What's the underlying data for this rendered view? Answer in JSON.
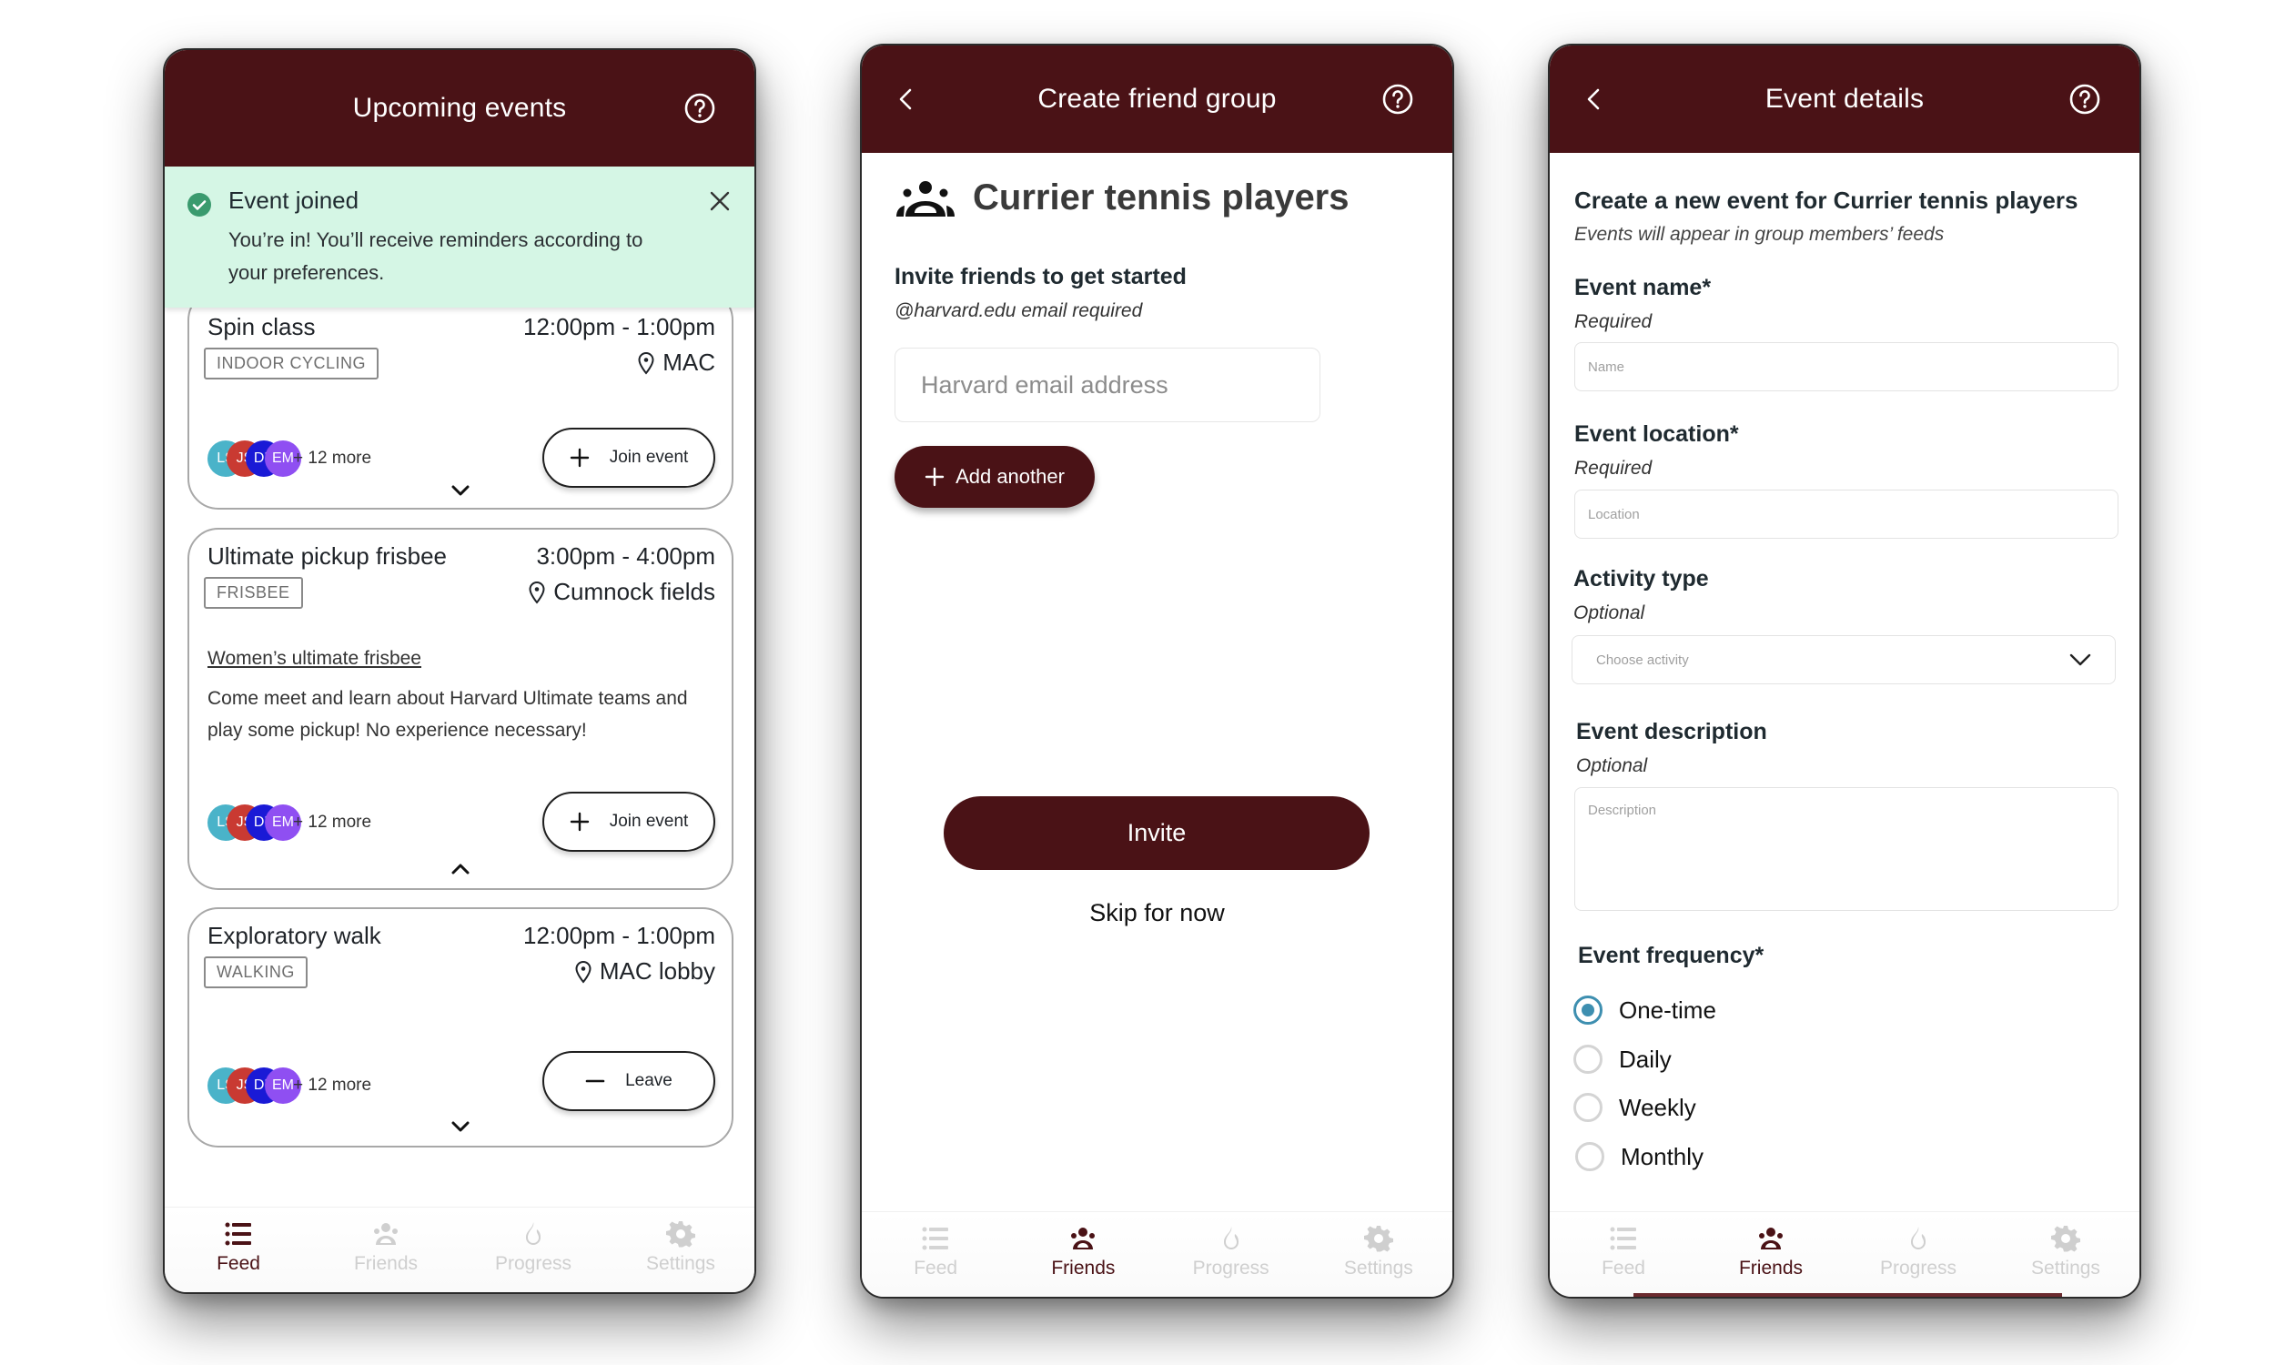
{
  "colors": {
    "brand": "#4a1216",
    "banner_bg": "#d5f6e5",
    "success": "#3a9a6e",
    "radio_accent": "#3e8fb0",
    "tab_inactive": "#cfcfcf"
  },
  "feed_screen": {
    "title": "Upcoming events",
    "help_icon": "help-circle-icon",
    "banner": {
      "icon": "check-circle-icon",
      "title": "Event joined",
      "message": "You’re in! You’ll receive reminders according to your preferences.",
      "close_icon": "close-icon"
    },
    "events": [
      {
        "title": "Spin class",
        "time": "12:00pm - 1:00pm",
        "tag": "INDOOR CYCLING",
        "location": "MAC",
        "group_link": "",
        "description": "",
        "attendees": [
          {
            "initials": "LS",
            "color": "#4ab3c9"
          },
          {
            "initials": "JS",
            "color": "#c93a32"
          },
          {
            "initials": "DK",
            "color": "#1a1ad6"
          },
          {
            "initials": "EM",
            "color": "#8f4ff2"
          }
        ],
        "more": "+ 12 more",
        "action": {
          "label": "Join event",
          "icon": "plus-icon"
        },
        "expand_icon": "chevron-down-icon"
      },
      {
        "title": "Ultimate pickup frisbee",
        "time": "3:00pm - 4:00pm",
        "tag": "FRISBEE",
        "location": "Cumnock fields",
        "group_link": "Women’s ultimate frisbee",
        "description": "Come meet and learn about Harvard Ultimate teams and play some pickup! No experience necessary!",
        "attendees": [
          {
            "initials": "LS",
            "color": "#4ab3c9"
          },
          {
            "initials": "JS",
            "color": "#c93a32"
          },
          {
            "initials": "DK",
            "color": "#1a1ad6"
          },
          {
            "initials": "EM",
            "color": "#8f4ff2"
          }
        ],
        "more": "+ 12 more",
        "action": {
          "label": "Join event",
          "icon": "plus-icon"
        },
        "expand_icon": "chevron-up-icon"
      },
      {
        "title": "Exploratory walk",
        "time": "12:00pm - 1:00pm",
        "tag": "WALKING",
        "location": "MAC lobby",
        "group_link": "",
        "description": "",
        "attendees": [
          {
            "initials": "LS",
            "color": "#4ab3c9"
          },
          {
            "initials": "JS",
            "color": "#c93a32"
          },
          {
            "initials": "DK",
            "color": "#1a1ad6"
          },
          {
            "initials": "EM",
            "color": "#8f4ff2"
          }
        ],
        "more": "+ 12 more",
        "action": {
          "label": "Leave",
          "icon": "minus-icon"
        },
        "expand_icon": "chevron-down-icon"
      }
    ],
    "active_tab": 0
  },
  "group_screen": {
    "title": "Create friend group",
    "group_name": "Currier tennis players",
    "invite_title": "Invite friends to get started",
    "invite_sub": "@harvard.edu email required",
    "email_placeholder": "Harvard email address",
    "email_value": "",
    "add_another_label": "Add another",
    "invite_label": "Invite",
    "skip_label": "Skip for now",
    "active_tab": 1
  },
  "details_screen": {
    "title": "Event details",
    "heading": "Create a new event for Currier tennis players",
    "subheading": "Events will appear in group members’ feeds",
    "fields": {
      "name": {
        "label": "Event name*",
        "hint": "Required",
        "placeholder": "Name",
        "value": ""
      },
      "location": {
        "label": "Event location*",
        "hint": "Required",
        "placeholder": "Location",
        "value": ""
      },
      "activity": {
        "label": "Activity type",
        "hint": "Optional",
        "placeholder": "Choose activity",
        "value": ""
      },
      "description": {
        "label": "Event description",
        "hint": "Optional",
        "placeholder": "Description",
        "value": ""
      }
    },
    "frequency": {
      "label": "Event frequency*",
      "options": [
        "One-time",
        "Daily",
        "Weekly",
        "Monthly"
      ],
      "selected": "One-time"
    },
    "active_tab": 1
  },
  "tabs": [
    {
      "label": "Feed",
      "icon": "list-icon"
    },
    {
      "label": "Friends",
      "icon": "group-icon"
    },
    {
      "label": "Progress",
      "icon": "flame-icon"
    },
    {
      "label": "Settings",
      "icon": "gear-icon"
    }
  ]
}
